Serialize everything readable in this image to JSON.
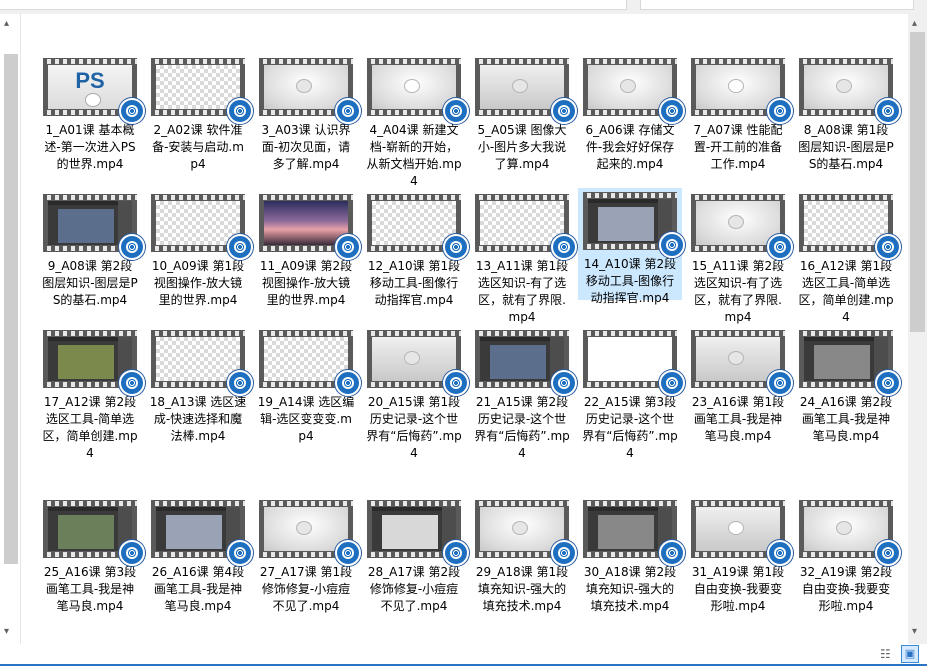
{
  "status": {
    "list_view_icon": "details-view-icon",
    "tiles_view_icon": "large-icons-view-icon"
  },
  "files": [
    {
      "name": "1_A01课 基本概述-第一次进入PS的世界.mp4",
      "thumb": "ps"
    },
    {
      "name": "2_A02课 软件准备-安装与启动.mp4",
      "thumb": "checker"
    },
    {
      "name": "3_A03课 认识界面-初次见面，请多了解.mp4",
      "thumb": "gray"
    },
    {
      "name": "4_A04课 新建文档-崭新的开始，从新文档开始.mp4",
      "thumb": "gray"
    },
    {
      "name": "5_A05课 图像大小-图片多大我说了算.mp4",
      "thumb": "studio"
    },
    {
      "name": "6_A06课 存储文件-我会好好保存起来的.mp4",
      "thumb": "gray"
    },
    {
      "name": "7_A07课 性能配置-开工前的准备工作.mp4",
      "thumb": "gray"
    },
    {
      "name": "8_A08课 第1段 图层知识-图层是PS的基石.mp4",
      "thumb": "gray"
    },
    {
      "name": "9_A08课 第2段 图层知识-图层是PS的基石.mp4",
      "thumb": "app"
    },
    {
      "name": "10_A09课 第1段 视图操作-放大镜里的世界.mp4",
      "thumb": "checker"
    },
    {
      "name": "11_A09课 第2段 视图操作-放大镜里的世界.mp4",
      "thumb": "sky"
    },
    {
      "name": "12_A10课 第1段 移动工具-图像行动指挥官.mp4",
      "thumb": "checker"
    },
    {
      "name": "13_A11课 第1段 选区知识-有了选区，就有了界限.mp4",
      "thumb": "checker"
    },
    {
      "name": "14_A10课 第2段 移动工具-图像行动指挥官.mp4",
      "thumb": "app",
      "selected": true
    },
    {
      "name": "15_A11课 第2段 选区知识-有了选区，就有了界限.mp4",
      "thumb": "gray"
    },
    {
      "name": "16_A12课 第1段 选区工具-简单选区，简单创建.mp4",
      "thumb": "checker"
    },
    {
      "name": "17_A12课 第2段 选区工具-简单选区，简单创建.mp4",
      "thumb": "app"
    },
    {
      "name": "18_A13课 选区速成-快速选择和魔法棒.mp4",
      "thumb": "checker"
    },
    {
      "name": "19_A14课 选区编辑-选区变变变.mp4",
      "thumb": "checker"
    },
    {
      "name": "20_A15课 第1段 历史记录-这个世界有“后悔药”.mp4",
      "thumb": "studio"
    },
    {
      "name": "21_A15课 第2段 历史记录-这个世界有“后悔药”.mp4",
      "thumb": "app"
    },
    {
      "name": "22_A15课 第3段 历史记录-这个世界有“后悔药”.mp4",
      "thumb": "white"
    },
    {
      "name": "23_A16课 第1段 画笔工具-我是神笔马良.mp4",
      "thumb": "studio"
    },
    {
      "name": "24_A16课 第2段 画笔工具-我是神笔马良.mp4",
      "thumb": "app"
    },
    {
      "name": "25_A16课 第3段 画笔工具-我是神笔马良.mp4",
      "thumb": "app"
    },
    {
      "name": "26_A16课 第4段 画笔工具-我是神笔马良.mp4",
      "thumb": "app"
    },
    {
      "name": "27_A17课 第1段 修饰修复-小痘痘不见了.mp4",
      "thumb": "gray"
    },
    {
      "name": "28_A17课 第2段 修饰修复-小痘痘不见了.mp4",
      "thumb": "app"
    },
    {
      "name": "29_A18课 第1段 填充知识-强大的填充技术.mp4",
      "thumb": "gray"
    },
    {
      "name": "30_A18课 第2段 填充知识-强大的填充技术.mp4",
      "thumb": "app"
    },
    {
      "name": "31_A19课 第1段 自由变换-我要变形啦.mp4",
      "thumb": "studio"
    },
    {
      "name": "32_A19课 第2段 自由变换-我要变形啦.mp4",
      "thumb": "gray"
    }
  ]
}
